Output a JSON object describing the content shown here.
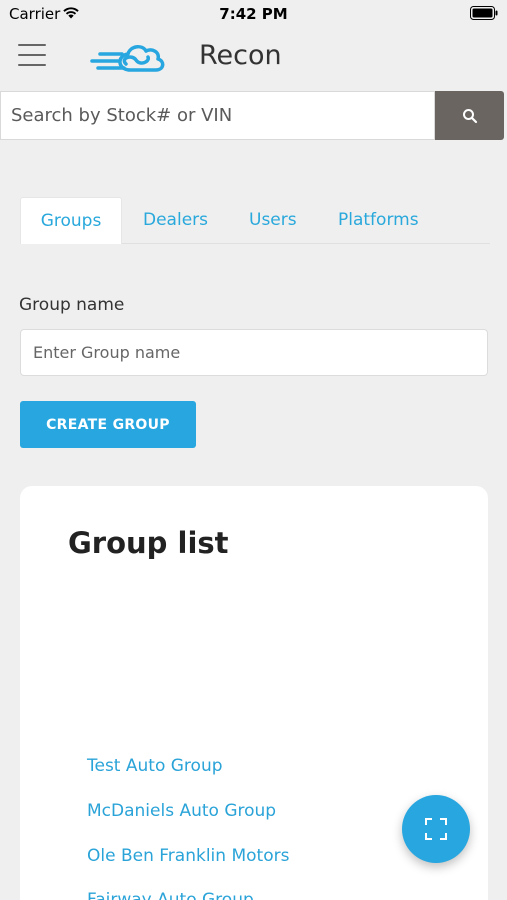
{
  "status_bar": {
    "carrier": "Carrier",
    "time": "7:42 PM"
  },
  "header": {
    "title": "Recon",
    "menu_icon": "hamburger-menu-icon",
    "logo_icon": "cloud-logo-icon"
  },
  "search": {
    "placeholder": "Search by Stock# or VIN",
    "icon": "search-icon"
  },
  "tabs": [
    {
      "label": "Groups",
      "active": true
    },
    {
      "label": "Dealers",
      "active": false
    },
    {
      "label": "Users",
      "active": false
    },
    {
      "label": "Platforms",
      "active": false
    }
  ],
  "form": {
    "label": "Group name",
    "placeholder": "Enter Group name",
    "create_label": "CREATE GROUP"
  },
  "group_list": {
    "title": "Group list",
    "items": [
      "Test Auto Group",
      "McDaniels Auto Group",
      "Ole Ben Franklin Motors",
      "Fairway Auto Group"
    ]
  },
  "fab": {
    "icon": "scan-icon"
  },
  "colors": {
    "accent": "#27a6e0",
    "search_button": "#6a6560",
    "background": "#efefef"
  }
}
